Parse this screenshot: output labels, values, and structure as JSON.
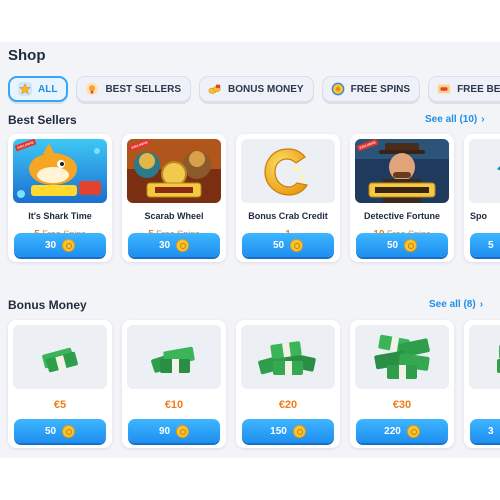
{
  "shop": {
    "title": "Shop",
    "filters": [
      {
        "label": "ALL",
        "icon": "star-icon",
        "active": true
      },
      {
        "label": "BEST SELLERS",
        "icon": "trophy-icon",
        "active": false
      },
      {
        "label": "BONUS MONEY",
        "icon": "coins-icon",
        "active": false
      },
      {
        "label": "FREE SPINS",
        "icon": "spin-coin-icon",
        "active": false
      },
      {
        "label": "FREE BETS",
        "icon": "ticket-icon",
        "active": false
      }
    ]
  },
  "best_sellers": {
    "title": "Best Sellers",
    "see_all": "See all (10)",
    "items": [
      {
        "name": "It's Shark Time",
        "amount": "5",
        "unit": "Free Spins",
        "price": "30",
        "thumb": "shark-game-thumbnail"
      },
      {
        "name": "Scarab Wheel",
        "amount": "5",
        "unit": "Free Spins",
        "price": "30",
        "thumb": "scarab-wheel-game-thumbnail"
      },
      {
        "name": "Bonus Crab Credit",
        "amount": "1",
        "unit": "",
        "price": "50",
        "thumb": "crab-credit-coin-icon"
      },
      {
        "name": "Detective Fortune",
        "amount": "10",
        "unit": "Free Spins",
        "price": "50",
        "thumb": "detective-fortune-game-thumbnail"
      },
      {
        "name": "Spo",
        "amount": "",
        "unit": "",
        "price": "5",
        "thumb": "partial-card"
      }
    ]
  },
  "bonus_money": {
    "title": "Bonus Money",
    "see_all": "See all (8)",
    "items": [
      {
        "value": "€5",
        "price": "50",
        "icon": "cash-stack-small-icon"
      },
      {
        "value": "€10",
        "price": "90",
        "icon": "cash-stack-medium-icon"
      },
      {
        "value": "€20",
        "price": "150",
        "icon": "cash-stack-large-icon"
      },
      {
        "value": "€30",
        "price": "220",
        "icon": "cash-stack-xlarge-icon"
      },
      {
        "value": "",
        "price": "3",
        "icon": "cash-stack-partial-icon"
      }
    ]
  },
  "colors": {
    "accent": "#1f8fe6",
    "price_orange": "#f07d1a",
    "button": "#2a9ef5"
  }
}
